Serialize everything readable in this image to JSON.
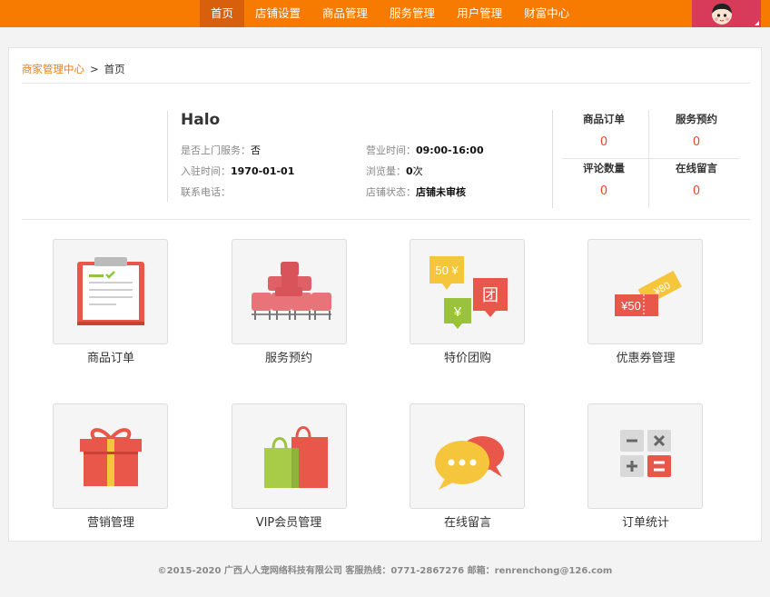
{
  "nav": {
    "items": [
      {
        "label": "首页",
        "active": true
      },
      {
        "label": "店铺设置",
        "active": false
      },
      {
        "label": "商品管理",
        "active": false
      },
      {
        "label": "服务管理",
        "active": false
      },
      {
        "label": "用户管理",
        "active": false
      },
      {
        "label": "财富中心",
        "active": false
      }
    ]
  },
  "breadcrumb": {
    "root": "商家管理中心",
    "separator": ">",
    "current": "首页"
  },
  "shop": {
    "name": "Halo",
    "door_service_label": "是否上门服务：",
    "door_service_value": "否",
    "hours_label": "营业时间：",
    "hours_value": "09:00-16:00",
    "join_label": "入驻时间：",
    "join_value": "1970-01-01",
    "views_label": "浏览量：",
    "views_value": "0",
    "views_unit": "次",
    "phone_label": "联系电话：",
    "phone_value": "",
    "status_label": "店铺状态：",
    "status_value": "店铺未审核"
  },
  "stats": [
    {
      "title": "商品订单",
      "value": "0"
    },
    {
      "title": "服务预约",
      "value": "0"
    },
    {
      "title": "评论数量",
      "value": "0"
    },
    {
      "title": "在线留言",
      "value": "0"
    }
  ],
  "tiles": [
    {
      "label": "商品订单",
      "icon": "clipboard-icon"
    },
    {
      "label": "服务预约",
      "icon": "seats-icon"
    },
    {
      "label": "特价团购",
      "icon": "group-buy-tags-icon"
    },
    {
      "label": "优惠券管理",
      "icon": "coupon-icon"
    },
    {
      "label": "营销管理",
      "icon": "gift-box-icon"
    },
    {
      "label": "VIP会员管理",
      "icon": "shopping-bags-icon"
    },
    {
      "label": "在线留言",
      "icon": "chat-bubbles-icon"
    },
    {
      "label": "订单统计",
      "icon": "calculator-icon"
    }
  ],
  "icon_text": {
    "tag50": "50 ¥",
    "tag_tuan": "团",
    "tag_yen": "¥",
    "coupon": "¥50",
    "coupon_back": "¥80"
  },
  "footer": {
    "text": "©2015-2020 广西人人宠网络科技有限公司 客服热线：0771-2867276 邮箱：renrenchong@126.com"
  },
  "colors": {
    "brand_orange": "#f77b00",
    "nav_active": "#d85f0b",
    "user_box": "#d83a5a",
    "stat_value": "#e8492b"
  }
}
